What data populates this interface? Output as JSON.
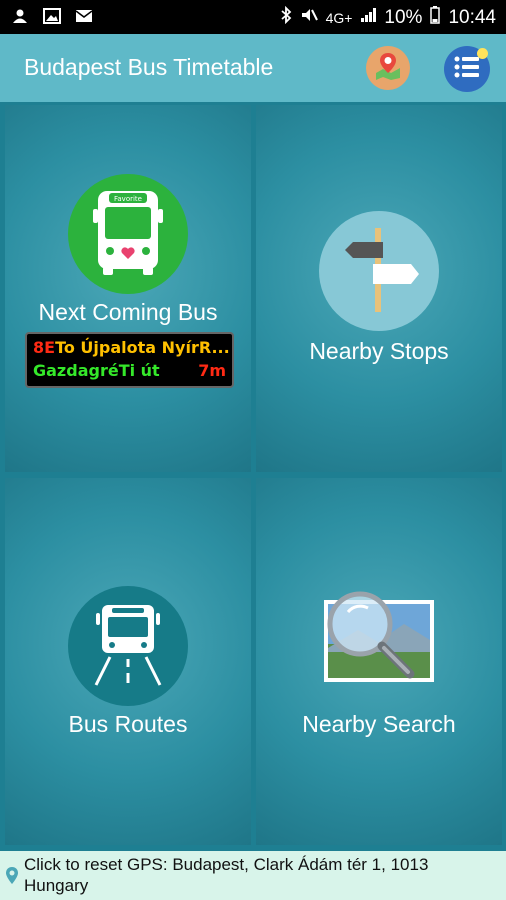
{
  "status_bar": {
    "network": "4G+",
    "battery": "10%",
    "time": "10:44"
  },
  "app_bar": {
    "title": "Budapest Bus Timetable"
  },
  "tiles": [
    {
      "label": "Next Coming Bus",
      "bus_badge": "Favorite",
      "next_bus": {
        "route": "8E",
        "destination": "To Újpalota NyírR...",
        "stop": "GazdagréTi út",
        "minutes": "7m"
      }
    },
    {
      "label": "Nearby Stops"
    },
    {
      "label": "Bus Routes"
    },
    {
      "label": "Nearby Search"
    }
  ],
  "bottom_bar": {
    "text": "Click to reset GPS: Budapest, Clark Ádám tér 1, 1013 Hungary"
  },
  "colors": {
    "app_bar": "#5fb9c8",
    "tile": "#2c8fa2",
    "bus_circle": "#2cb23d",
    "bottom_bar": "#d8f4ea",
    "led_route": "#ff2a14",
    "led_destination": "#ffc000",
    "led_stop": "#35e82a"
  },
  "icons": [
    "person-icon",
    "image-icon",
    "mail-icon",
    "bluetooth-icon",
    "mute-icon",
    "signal-icon",
    "battery-icon",
    "map-marker-icon",
    "list-menu-icon",
    "bus-front-icon",
    "signpost-icon",
    "bus-road-icon",
    "magnifier-photo-icon",
    "location-pin-icon"
  ]
}
